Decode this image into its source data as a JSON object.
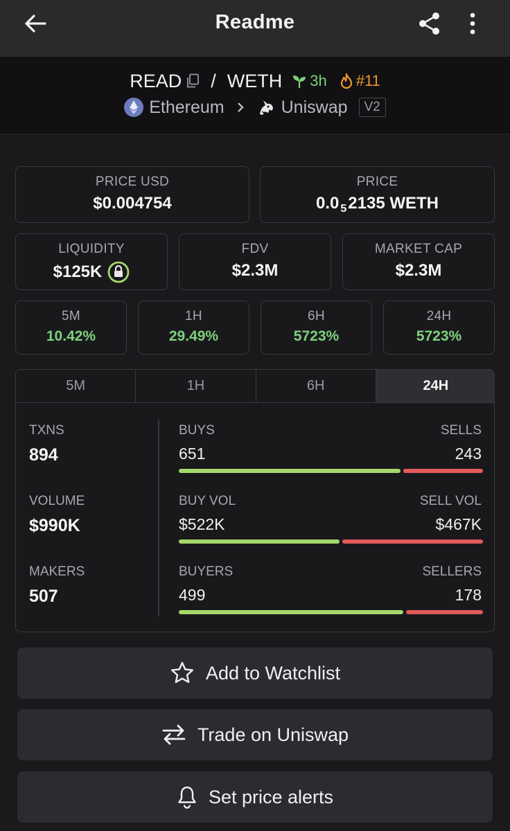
{
  "header": {
    "title": "Readme",
    "back_icon": "arrow-left-icon",
    "share_icon": "share-icon",
    "more_icon": "more-vertical-icon"
  },
  "pair": {
    "base": "READ",
    "separator": "/",
    "quote": "WETH",
    "age": "3h",
    "rank": "#11",
    "chain": "Ethereum",
    "dex": "Uniswap",
    "dex_version": "V2"
  },
  "price": {
    "usd_label": "PRICE USD",
    "usd_value": "$0.004754",
    "native_label": "PRICE",
    "native_prefix": "0.0",
    "native_subscript": "5",
    "native_suffix": "2135 WETH"
  },
  "market": {
    "liquidity_label": "LIQUIDITY",
    "liquidity_value": "$125K",
    "fdv_label": "FDV",
    "fdv_value": "$2.3M",
    "mcap_label": "MARKET CAP",
    "mcap_value": "$2.3M"
  },
  "changes": [
    {
      "label": "5M",
      "value": "10.42%"
    },
    {
      "label": "1H",
      "value": "29.49%"
    },
    {
      "label": "6H",
      "value": "5723%"
    },
    {
      "label": "24H",
      "value": "5723%"
    }
  ],
  "stats": {
    "tabs": [
      "5M",
      "1H",
      "6H",
      "24H"
    ],
    "active_tab": "24H",
    "txns_label": "TXNS",
    "txns_value": "894",
    "volume_label": "VOLUME",
    "volume_value": "$990K",
    "makers_label": "MAKERS",
    "makers_value": "507",
    "buys_label": "BUYS",
    "sells_label": "SELLS",
    "buys_value": "651",
    "sells_value": "243",
    "buys_fraction": 0.728,
    "buy_vol_label": "BUY VOL",
    "sell_vol_label": "SELL VOL",
    "buy_vol_value": "$522K",
    "sell_vol_value": "$467K",
    "buy_vol_fraction": 0.528,
    "buyers_label": "BUYERS",
    "sellers_label": "SELLERS",
    "buyers_value": "499",
    "sellers_value": "178",
    "buyers_fraction": 0.737
  },
  "actions": {
    "watchlist": "Add to Watchlist",
    "trade": "Trade on Uniswap",
    "alerts": "Set price alerts"
  },
  "colors": {
    "green": "#7ed17c",
    "buy_bar": "#a5d86a",
    "sell_bar": "#e25b5b",
    "rank": "#f0962e"
  }
}
